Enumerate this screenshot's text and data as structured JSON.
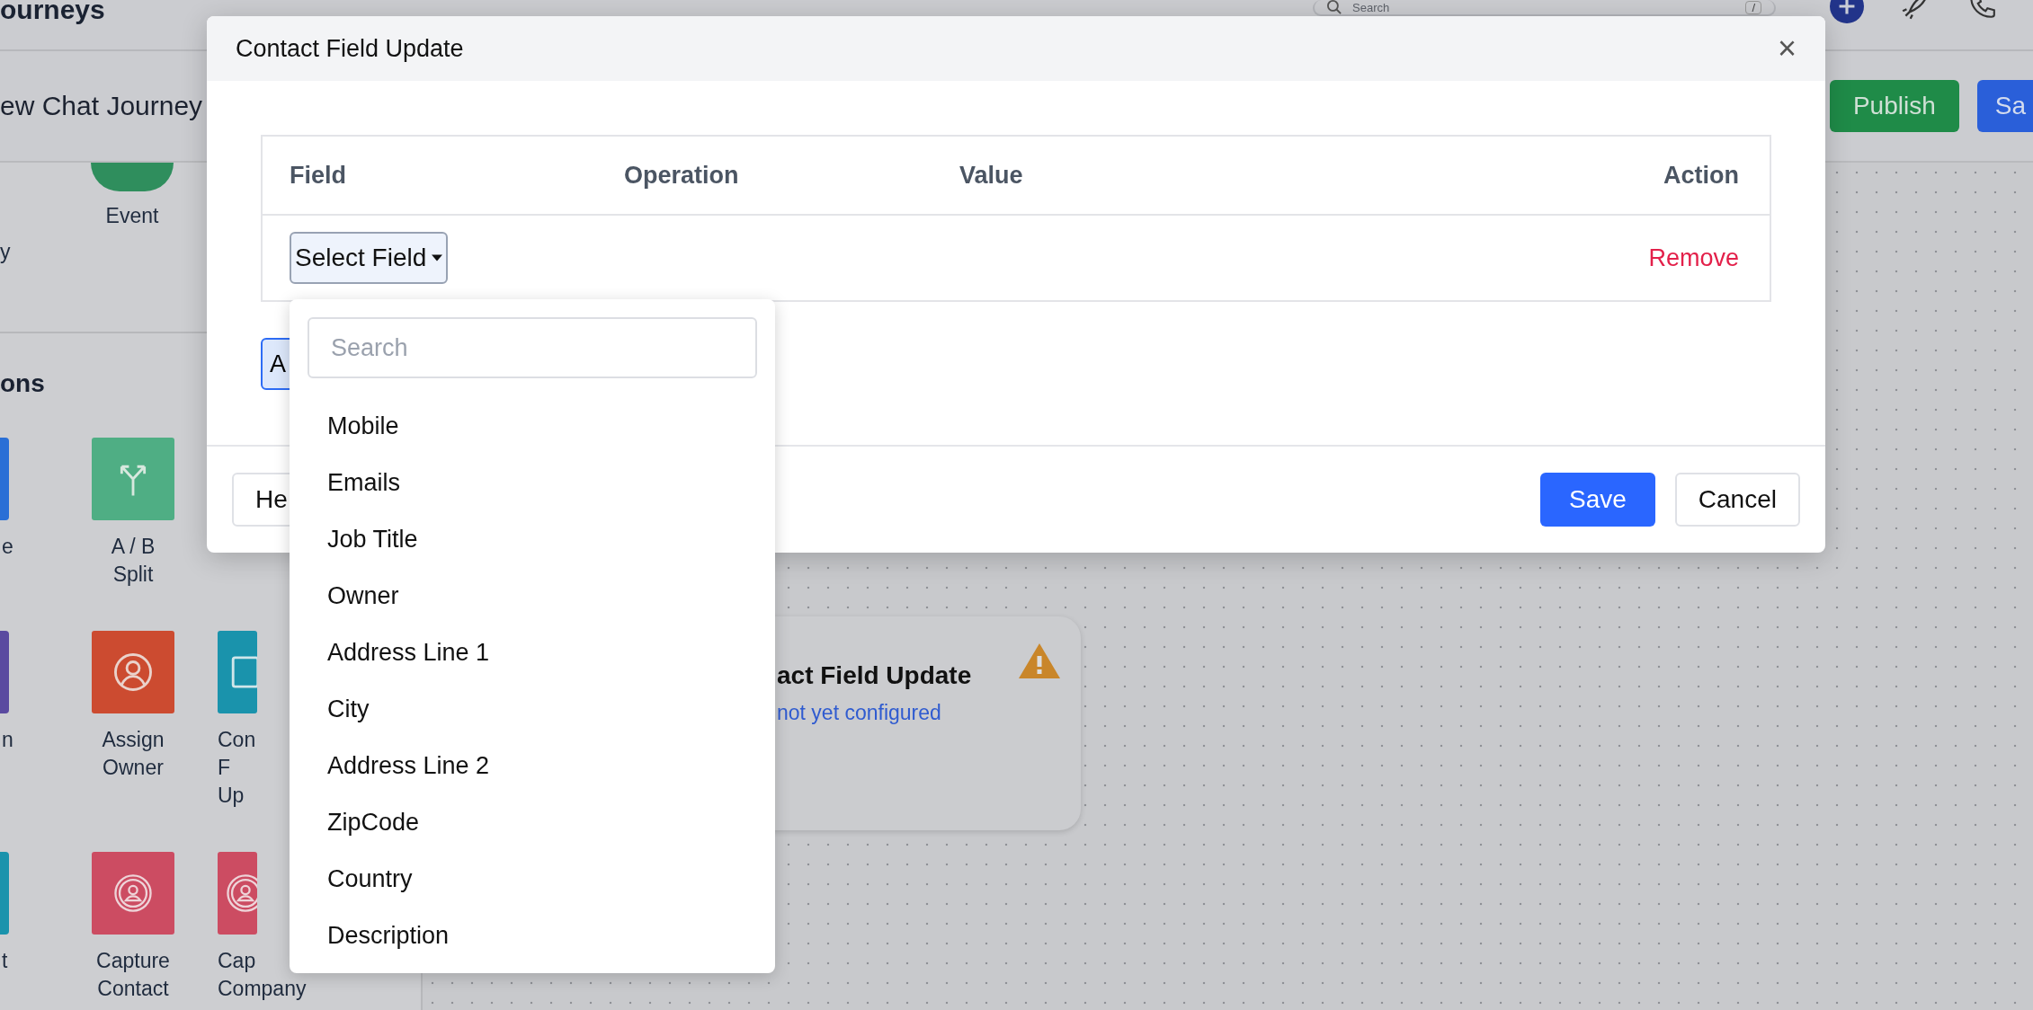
{
  "app_header": {
    "title": "ourneys",
    "search": {
      "placeholder": "Search",
      "shortcut": "/"
    }
  },
  "journey_bar": {
    "title": "ew Chat Journey",
    "buttons": [
      {
        "label": "Publish",
        "kind": "publish"
      },
      {
        "label": "Sa",
        "kind": "primary"
      }
    ]
  },
  "sidebar": {
    "triggers": [
      {
        "kind": "label",
        "label": "y"
      },
      {
        "kind": "circle",
        "label": "Event"
      }
    ],
    "section_title": "ons",
    "tile_rows": [
      [
        {
          "lines": [
            "e"
          ],
          "color": "#2a6fd6",
          "kind": "plain"
        },
        {
          "lines": [
            "A / B",
            "Split"
          ],
          "color": "#4fae84",
          "kind": "split"
        }
      ],
      [
        {
          "lines": [
            "n"
          ],
          "color": "#5a4aa0",
          "kind": "plain"
        },
        {
          "lines": [
            "Assign",
            "Owner"
          ],
          "color": "#cc4b30",
          "kind": "person"
        },
        {
          "lines": [
            "Con",
            "F",
            "Up"
          ],
          "color": "#1a93ac",
          "kind": "doc"
        }
      ],
      [
        {
          "lines": [
            "t"
          ],
          "color": "#1a93ac",
          "kind": "plain"
        },
        {
          "lines": [
            "Capture",
            "Contact"
          ],
          "color": "#cc4c62",
          "kind": "badge"
        },
        {
          "lines": [
            "Cap",
            "Company"
          ],
          "color": "#cc4c62",
          "kind": "badge"
        }
      ]
    ]
  },
  "canvas": {
    "node": {
      "title": "act Field Update",
      "status": "not yet configured",
      "warning": true
    }
  },
  "modal": {
    "title": "Contact Field Update",
    "close": "×",
    "table": {
      "columns": [
        "Field",
        "Operation",
        "Value",
        "Action"
      ],
      "rows": [
        {
          "field": "Select Field",
          "remove": "Remove"
        }
      ]
    },
    "add_button": "A",
    "help_button": "He",
    "buttons": [
      {
        "label": "Save",
        "kind": "primary"
      },
      {
        "label": "Cancel",
        "kind": "secondary"
      }
    ]
  },
  "dropdown": {
    "search": {
      "placeholder": "Search"
    },
    "options": [
      "Mobile",
      "Emails",
      "Job Title",
      "Owner",
      "Address Line 1",
      "City",
      "Address Line 2",
      "ZipCode",
      "Country",
      "Description"
    ]
  }
}
